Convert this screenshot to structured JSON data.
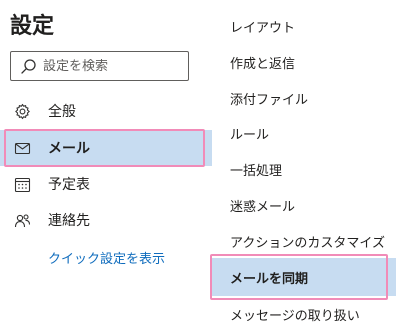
{
  "header": {
    "title": "設定"
  },
  "search": {
    "placeholder": "設定を検索"
  },
  "nav": {
    "items": [
      {
        "label": "全般",
        "icon": "gear-icon"
      },
      {
        "label": "メール",
        "icon": "mail-icon",
        "selected": true
      },
      {
        "label": "予定表",
        "icon": "calendar-icon"
      },
      {
        "label": "連絡先",
        "icon": "people-icon"
      }
    ],
    "quick_link": "クイック設定を表示"
  },
  "submenu": {
    "items": [
      {
        "label": "レイアウト"
      },
      {
        "label": "作成と返信"
      },
      {
        "label": "添付ファイル"
      },
      {
        "label": "ルール"
      },
      {
        "label": "一括処理"
      },
      {
        "label": "迷惑メール"
      },
      {
        "label": "アクションのカスタマイズ"
      },
      {
        "label": "メールを同期",
        "selected": true
      },
      {
        "label": "メッセージの取り扱い"
      }
    ]
  },
  "colors": {
    "selected_bg": "#c7dcf1",
    "highlight_border": "#f18bb8",
    "link": "#0f6cbd"
  }
}
